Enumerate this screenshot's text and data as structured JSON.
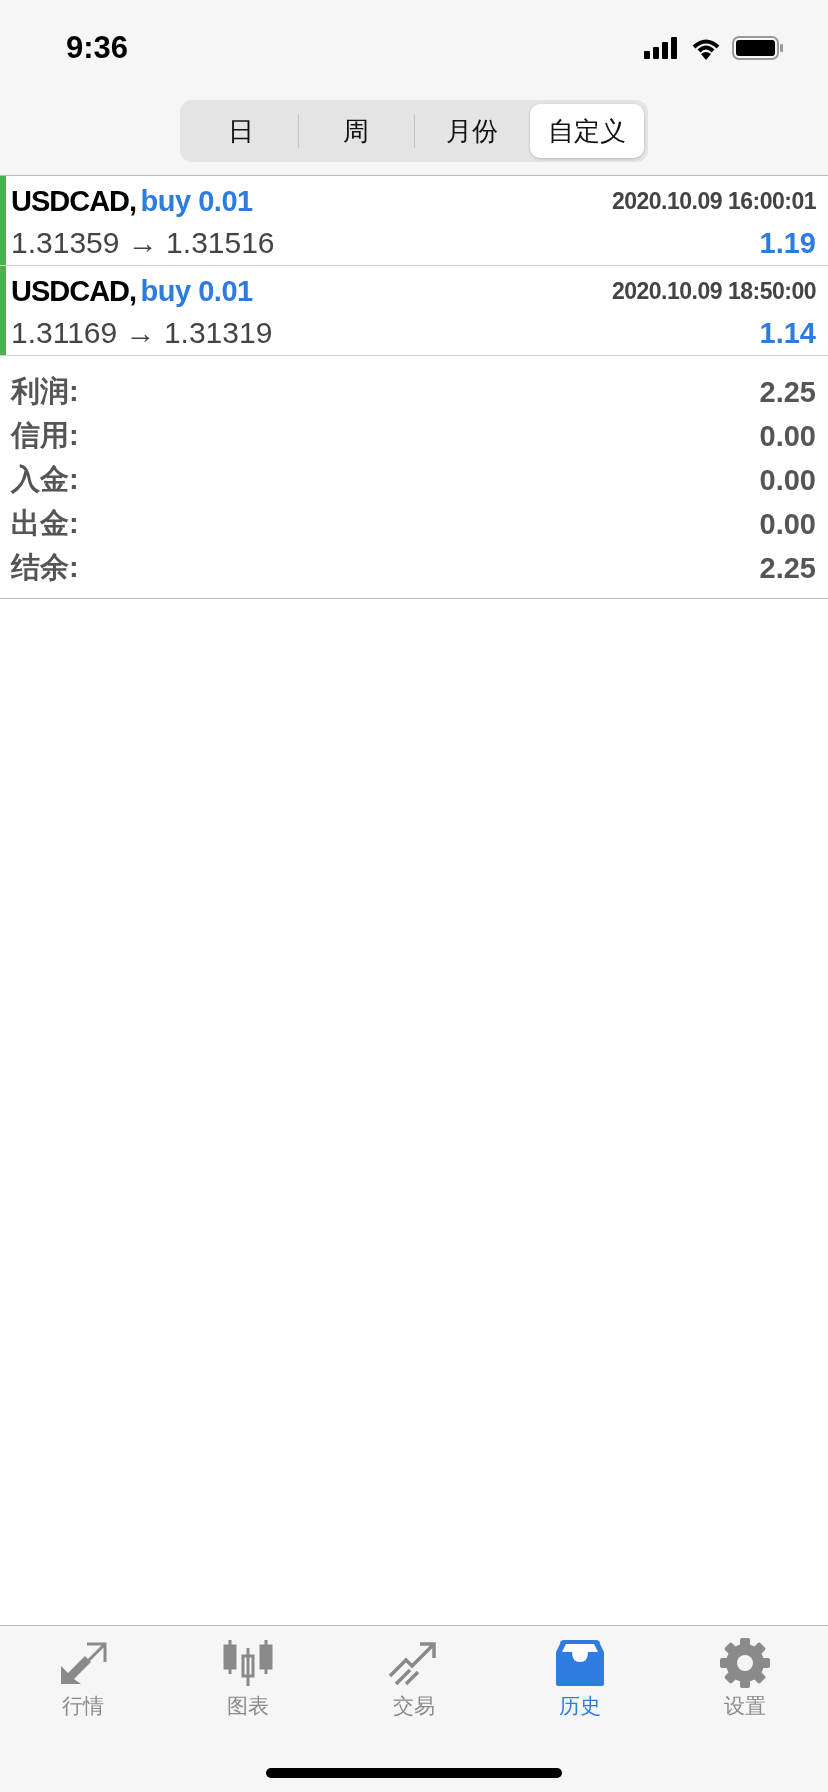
{
  "status_bar": {
    "time": "9:36"
  },
  "period_tabs": [
    {
      "label": "日",
      "selected": false
    },
    {
      "label": "周",
      "selected": false
    },
    {
      "label": "月份",
      "selected": false
    },
    {
      "label": "自定义",
      "selected": true
    }
  ],
  "deals": [
    {
      "symbol": "USDCAD,",
      "action": "buy 0.01",
      "time": "2020.10.09 16:00:01",
      "prices": "1.31359 → 1.31516",
      "profit": "1.19",
      "color": "#4caf50"
    },
    {
      "symbol": "USDCAD,",
      "action": "buy 0.01",
      "time": "2020.10.09 18:50:00",
      "prices": "1.31169 → 1.31319",
      "profit": "1.14",
      "color": "#4caf50"
    }
  ],
  "summary": [
    {
      "label": "利润:",
      "value": "2.25"
    },
    {
      "label": "信用:",
      "value": "0.00"
    },
    {
      "label": "入金:",
      "value": "0.00"
    },
    {
      "label": "出金:",
      "value": "0.00"
    },
    {
      "label": "结余:",
      "value": "2.25"
    }
  ],
  "tab_bar": [
    {
      "kind": "quotes",
      "label": "行情",
      "selected": false
    },
    {
      "kind": "chart",
      "label": "图表",
      "selected": false
    },
    {
      "kind": "trade",
      "label": "交易",
      "selected": false
    },
    {
      "kind": "history",
      "label": "历史",
      "selected": true
    },
    {
      "kind": "settings",
      "label": "设置",
      "selected": false
    }
  ]
}
